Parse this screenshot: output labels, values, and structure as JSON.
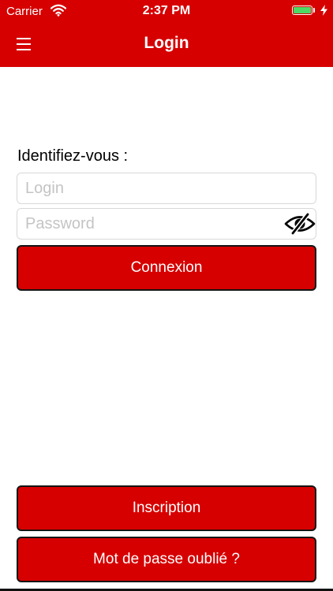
{
  "status_bar": {
    "carrier": "Carrier",
    "time": "2:37 PM",
    "wifi_icon": "wifi-icon",
    "battery_icon": "battery-icon",
    "battery_level": 1.0,
    "charging_icon": "bolt-icon",
    "battery_color": "#4cd964"
  },
  "nav": {
    "title": "Login",
    "menu_icon": "hamburger-menu-icon"
  },
  "form": {
    "prompt": "Identifiez-vous :",
    "login_placeholder": "Login",
    "login_value": "",
    "password_placeholder": "Password",
    "password_value": "",
    "password_toggle_icon": "eye-slash-icon",
    "submit_label": "Connexion"
  },
  "footer": {
    "register_label": "Inscription",
    "forgot_label": "Mot de passe oublié ?"
  },
  "colors": {
    "brand": "#d60000",
    "button_border": "#141414",
    "field_border": "#d8d8d8",
    "placeholder": "#c4c4c4"
  }
}
